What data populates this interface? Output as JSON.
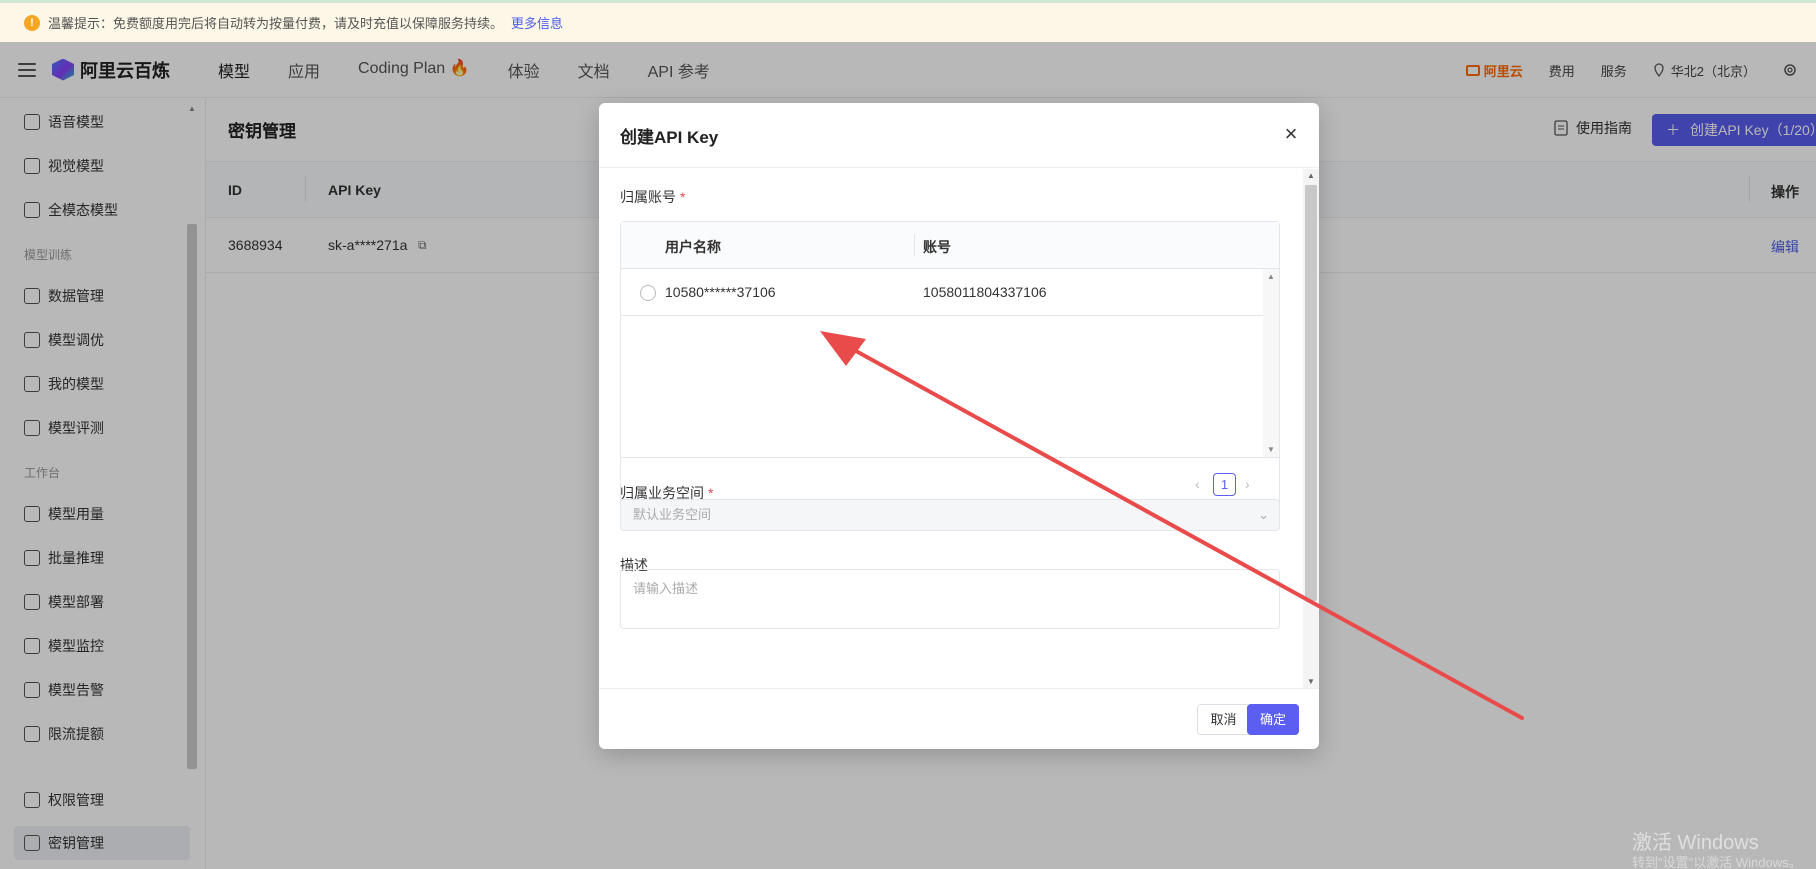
{
  "notice": {
    "text": "温馨提示：免费额度用完后将自动转为按量付费，请及时充值以保障服务持续。",
    "more": "更多信息"
  },
  "header": {
    "logo": "阿里云百炼",
    "tabs": [
      "模型",
      "应用",
      "Coding Plan 🔥",
      "体验",
      "文档",
      "API 参考"
    ],
    "aliyun": "阿里云",
    "fees": "费用",
    "service": "服务",
    "region": "华北2（北京）"
  },
  "sidebar": {
    "items": [
      {
        "label": "语音模型",
        "icon": "audio-wave-icon"
      },
      {
        "label": "视觉模型",
        "icon": "camera-icon"
      },
      {
        "label": "全模态模型",
        "icon": "multimodal-icon"
      }
    ],
    "group_training": "模型训练",
    "training_items": [
      {
        "label": "数据管理",
        "icon": "chart-line-icon"
      },
      {
        "label": "模型调优",
        "icon": "sliders-icon"
      },
      {
        "label": "我的模型",
        "icon": "grid-icon"
      },
      {
        "label": "模型评测",
        "icon": "compass-icon"
      }
    ],
    "group_workbench": "工作台",
    "workbench_items": [
      {
        "label": "模型用量",
        "icon": "bar-chart-icon"
      },
      {
        "label": "批量推理",
        "icon": "list-icon"
      },
      {
        "label": "模型部署",
        "icon": "download-icon"
      },
      {
        "label": "模型监控",
        "icon": "pie-chart-icon"
      },
      {
        "label": "模型告警",
        "icon": "alarm-icon"
      },
      {
        "label": "限流提额",
        "icon": "database-icon"
      }
    ],
    "bottom_items": [
      {
        "label": "权限管理",
        "icon": "user-icon"
      },
      {
        "label": "密钥管理",
        "icon": "key-icon"
      }
    ]
  },
  "page": {
    "title": "密钥管理",
    "guide": "使用指南",
    "create_btn": "创建API Key（1/20）",
    "columns": [
      "ID",
      "API Key",
      "操作"
    ],
    "row": {
      "id": "3688934",
      "key": "sk-a****271a",
      "action": "编辑"
    }
  },
  "modal": {
    "title": "创建API Key",
    "account_label": "归属账号",
    "col_username": "用户名称",
    "col_account": "账号",
    "row_username": "10580******37106",
    "row_account": "1058011804337106",
    "page_num": "1",
    "workspace_label": "归属业务空间",
    "workspace_placeholder": "默认业务空间",
    "desc_label": "描述",
    "desc_placeholder": "请输入描述",
    "cancel": "取消",
    "ok": "确定"
  },
  "watermark": {
    "line1": "激活 Windows",
    "line2": "转到\"设置\"以激活 Windows。"
  },
  "colors": {
    "accent": "#5b5ef0",
    "arrow": "#e94b4b",
    "brand": "#ff6a00"
  }
}
